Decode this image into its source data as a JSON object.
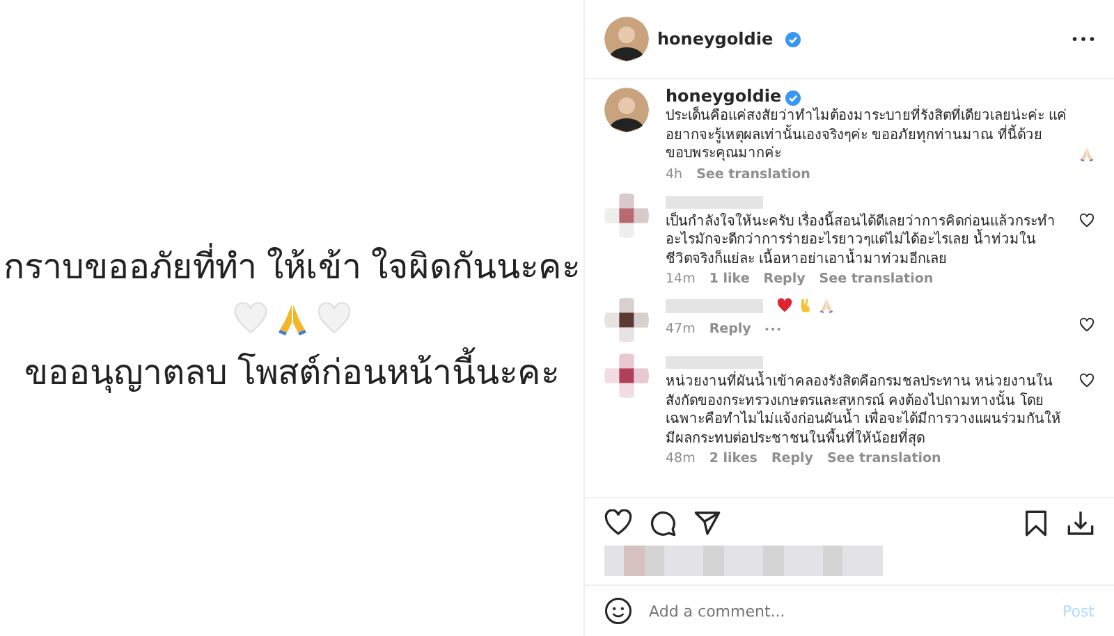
{
  "photo": {
    "lines": [
      "กราบขออภัยที่ทำ ให้เข้า ใจผิดกันนะคะ",
      "ขออนุญาตลบ โพสต์ก่อนหน้านี้นะคะ"
    ]
  },
  "header": {
    "username": "honeygoldie",
    "verified": true
  },
  "caption": {
    "username": "honeygoldie",
    "verified": true,
    "text": "ประเด็นคือแค่สงสัยว่าทำไมต้องมาระบายที่รังสิตที่เดียวเลยน่ะค่ะ แค่อยากจะรู้เหตุผลเท่านั้นเองจริงๆค่ะ ขออภัยทุกท่านมาณ ที่นี้ด้วย ขอบพระคุณมากค่ะ",
    "time": "4h",
    "translate": "See translation"
  },
  "comments": [
    {
      "kind": "text",
      "text": "เป็นกำลังใจให้นะครับ เรื่องนี้สอนได้ดีเลยว่าการคิดก่อนแล้วกระทำอะไรมักจะดีกว่าการร่ายอะไรยาวๆแต่ไม่ได้อะไรเลย น้ำท่วมในชีวิตจริงก็แย่ละ เนื้อหาอย่าเอาน้ำมาท่วมอีกเลย",
      "meta": [
        "14m",
        "1 like",
        "Reply",
        "See translation"
      ],
      "has_more": false
    },
    {
      "kind": "emoji",
      "meta": [
        "47m",
        "Reply"
      ],
      "has_more": true
    },
    {
      "kind": "text",
      "text": "หน่วยงานที่ผันน้ำเข้าคลองรังสิตคือกรมชลประทาน หน่วยงานในสังกัดของกระทรวงเกษตรและสหกรณ์ คงต้องไปถามทางนั้น โดยเฉพาะคือทำไมไม่แจ้งก่อนผันน้ำ เพื่อจะได้มีการวางแผนร่วมกันให้มีผลกระทบต่อประชาชนในพื้นที่ให้น้อยที่สุด",
      "meta": [
        "48m",
        "2 likes",
        "Reply",
        "See translation"
      ],
      "has_more": false
    }
  ],
  "add_comment": {
    "placeholder": "Add a comment...",
    "post": "Post",
    "post_disabled": true
  }
}
